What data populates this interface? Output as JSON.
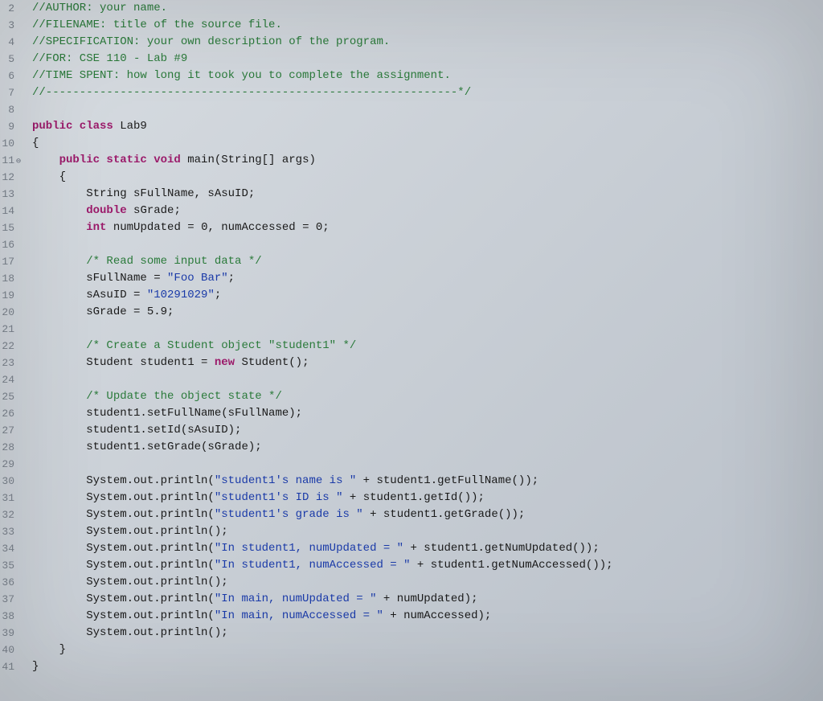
{
  "lines": [
    {
      "n": 2,
      "fold": "",
      "segs": [
        [
          "c-comment",
          "//AUTHOR: your name."
        ]
      ]
    },
    {
      "n": 3,
      "fold": "",
      "segs": [
        [
          "c-comment",
          "//FILENAME: title of the source file."
        ]
      ]
    },
    {
      "n": 4,
      "fold": "",
      "segs": [
        [
          "c-comment",
          "//SPECIFICATION: your own description of the program."
        ]
      ]
    },
    {
      "n": 5,
      "fold": "",
      "segs": [
        [
          "c-comment",
          "//FOR: CSE 110 - Lab #9"
        ]
      ]
    },
    {
      "n": 6,
      "fold": "",
      "segs": [
        [
          "c-comment",
          "//TIME SPENT: how long it took you to complete the assignment."
        ]
      ]
    },
    {
      "n": 7,
      "fold": "",
      "segs": [
        [
          "c-comment",
          "//-------------------------------------------------------------*/"
        ]
      ]
    },
    {
      "n": 8,
      "fold": "",
      "segs": [
        [
          "",
          ""
        ]
      ]
    },
    {
      "n": 9,
      "fold": "",
      "segs": [
        [
          "c-keyword",
          "public class"
        ],
        [
          "",
          " Lab9"
        ]
      ]
    },
    {
      "n": 10,
      "fold": "",
      "segs": [
        [
          "",
          "{"
        ]
      ]
    },
    {
      "n": 11,
      "fold": "⊖",
      "segs": [
        [
          "",
          "    "
        ],
        [
          "c-keyword",
          "public static void"
        ],
        [
          "",
          " main(String[] args)"
        ]
      ]
    },
    {
      "n": 12,
      "fold": "",
      "segs": [
        [
          "",
          "    {"
        ]
      ]
    },
    {
      "n": 13,
      "fold": "",
      "segs": [
        [
          "",
          "        String sFullName, sAsuID;"
        ]
      ]
    },
    {
      "n": 14,
      "fold": "",
      "segs": [
        [
          "",
          "        "
        ],
        [
          "c-keyword",
          "double"
        ],
        [
          "",
          " sGrade;"
        ]
      ]
    },
    {
      "n": 15,
      "fold": "",
      "segs": [
        [
          "",
          "        "
        ],
        [
          "c-keyword",
          "int"
        ],
        [
          "",
          " numUpdated = "
        ],
        [
          "c-number",
          "0"
        ],
        [
          "",
          ", numAccessed = "
        ],
        [
          "c-number",
          "0"
        ],
        [
          "",
          ";"
        ]
      ]
    },
    {
      "n": 16,
      "fold": "",
      "segs": [
        [
          "",
          ""
        ]
      ]
    },
    {
      "n": 17,
      "fold": "",
      "segs": [
        [
          "",
          "        "
        ],
        [
          "c-comment",
          "/* Read some input data */"
        ]
      ]
    },
    {
      "n": 18,
      "fold": "",
      "segs": [
        [
          "",
          "        sFullName = "
        ],
        [
          "c-string",
          "\"Foo Bar\""
        ],
        [
          "",
          ";"
        ]
      ]
    },
    {
      "n": 19,
      "fold": "",
      "segs": [
        [
          "",
          "        sAsuID = "
        ],
        [
          "c-string",
          "\"10291029\""
        ],
        [
          "",
          ";"
        ]
      ]
    },
    {
      "n": 20,
      "fold": "",
      "segs": [
        [
          "",
          "        sGrade = "
        ],
        [
          "c-number",
          "5.9"
        ],
        [
          "",
          ";"
        ]
      ]
    },
    {
      "n": 21,
      "fold": "",
      "segs": [
        [
          "",
          ""
        ]
      ]
    },
    {
      "n": 22,
      "fold": "",
      "segs": [
        [
          "",
          "        "
        ],
        [
          "c-comment",
          "/* Create a Student object \"student1\" */"
        ]
      ]
    },
    {
      "n": 23,
      "fold": "",
      "segs": [
        [
          "",
          "        Student student1 = "
        ],
        [
          "c-keyword",
          "new"
        ],
        [
          "",
          " Student();"
        ]
      ]
    },
    {
      "n": 24,
      "fold": "",
      "segs": [
        [
          "",
          ""
        ]
      ]
    },
    {
      "n": 25,
      "fold": "",
      "segs": [
        [
          "",
          "        "
        ],
        [
          "c-comment",
          "/* Update the object state */"
        ]
      ]
    },
    {
      "n": 26,
      "fold": "",
      "segs": [
        [
          "",
          "        student1.setFullName(sFullName);"
        ]
      ]
    },
    {
      "n": 27,
      "fold": "",
      "segs": [
        [
          "",
          "        student1.setId(sAsuID);"
        ]
      ]
    },
    {
      "n": 28,
      "fold": "",
      "segs": [
        [
          "",
          "        student1.setGrade(sGrade);"
        ]
      ]
    },
    {
      "n": 29,
      "fold": "",
      "segs": [
        [
          "",
          ""
        ]
      ]
    },
    {
      "n": 30,
      "fold": "",
      "segs": [
        [
          "",
          "        System.out.println("
        ],
        [
          "c-string",
          "\"student1's name is \""
        ],
        [
          "",
          " + student1.getFullName());"
        ]
      ]
    },
    {
      "n": 31,
      "fold": "",
      "segs": [
        [
          "",
          "        System.out.println("
        ],
        [
          "c-string",
          "\"student1's ID is \""
        ],
        [
          "",
          " + student1.getId());"
        ]
      ]
    },
    {
      "n": 32,
      "fold": "",
      "segs": [
        [
          "",
          "        System.out.println("
        ],
        [
          "c-string",
          "\"student1's grade is \""
        ],
        [
          "",
          " + student1.getGrade());"
        ]
      ]
    },
    {
      "n": 33,
      "fold": "",
      "segs": [
        [
          "",
          "        System.out.println();"
        ]
      ]
    },
    {
      "n": 34,
      "fold": "",
      "segs": [
        [
          "",
          "        System.out.println("
        ],
        [
          "c-string",
          "\"In student1, numUpdated = \""
        ],
        [
          "",
          " + student1.getNumUpdated());"
        ]
      ]
    },
    {
      "n": 35,
      "fold": "",
      "segs": [
        [
          "",
          "        System.out.println("
        ],
        [
          "c-string",
          "\"In student1, numAccessed = \""
        ],
        [
          "",
          " + student1.getNumAccessed());"
        ]
      ]
    },
    {
      "n": 36,
      "fold": "",
      "segs": [
        [
          "",
          "        System.out.println();"
        ]
      ]
    },
    {
      "n": 37,
      "fold": "",
      "segs": [
        [
          "",
          "        System.out.println("
        ],
        [
          "c-string",
          "\"In main, numUpdated = \""
        ],
        [
          "",
          " + numUpdated);"
        ]
      ]
    },
    {
      "n": 38,
      "fold": "",
      "segs": [
        [
          "",
          "        System.out.println("
        ],
        [
          "c-string",
          "\"In main, numAccessed = \""
        ],
        [
          "",
          " + numAccessed);"
        ]
      ]
    },
    {
      "n": 39,
      "fold": "",
      "segs": [
        [
          "",
          "        System.out.println();"
        ]
      ]
    },
    {
      "n": 40,
      "fold": "",
      "segs": [
        [
          "",
          "    }"
        ]
      ]
    },
    {
      "n": 41,
      "fold": "",
      "segs": [
        [
          "",
          "}"
        ]
      ]
    }
  ]
}
